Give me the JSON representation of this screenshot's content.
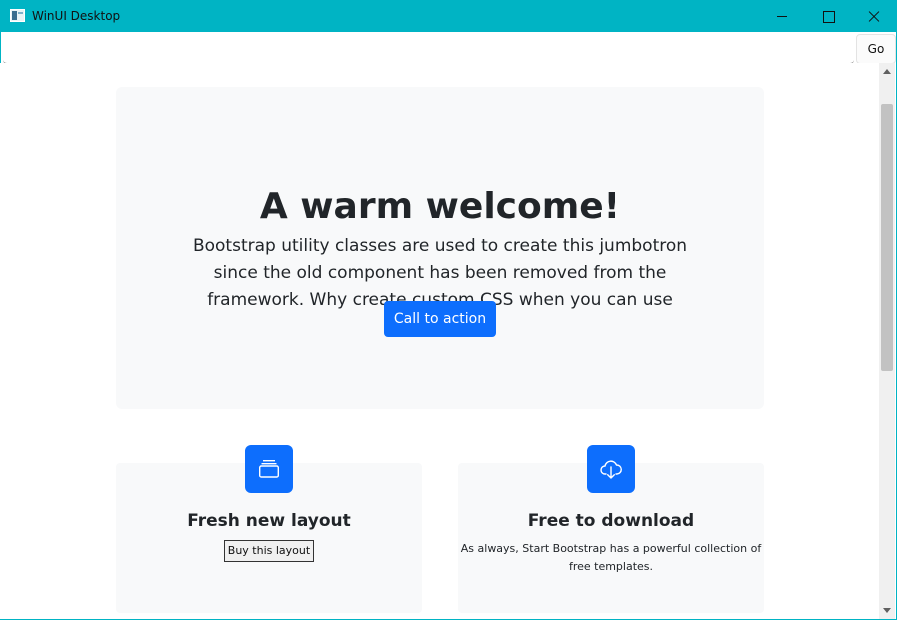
{
  "window": {
    "title": "WinUI Desktop",
    "accent_color": "#00b4c4",
    "controls": [
      "minimize-icon",
      "maximize-icon",
      "close-icon"
    ]
  },
  "address_bar": {
    "url_value": "",
    "go_label": "Go"
  },
  "jumbotron": {
    "title": "A warm welcome!",
    "lead": "Bootstrap utility classes are used to create this jumbotron since the old component has been removed from the framework. Why create custom CSS when you can use utilities?",
    "cta_label": "Call to action",
    "background": "#f8f9fa",
    "button_color": "#0d6efd"
  },
  "features": [
    {
      "icon": "collection-icon",
      "title": "Fresh new layout",
      "button_label": "Buy this layout"
    },
    {
      "icon": "cloud-download-icon",
      "title": "Free to download",
      "text": "As always, Start Bootstrap has a powerful collection of free templates."
    }
  ]
}
